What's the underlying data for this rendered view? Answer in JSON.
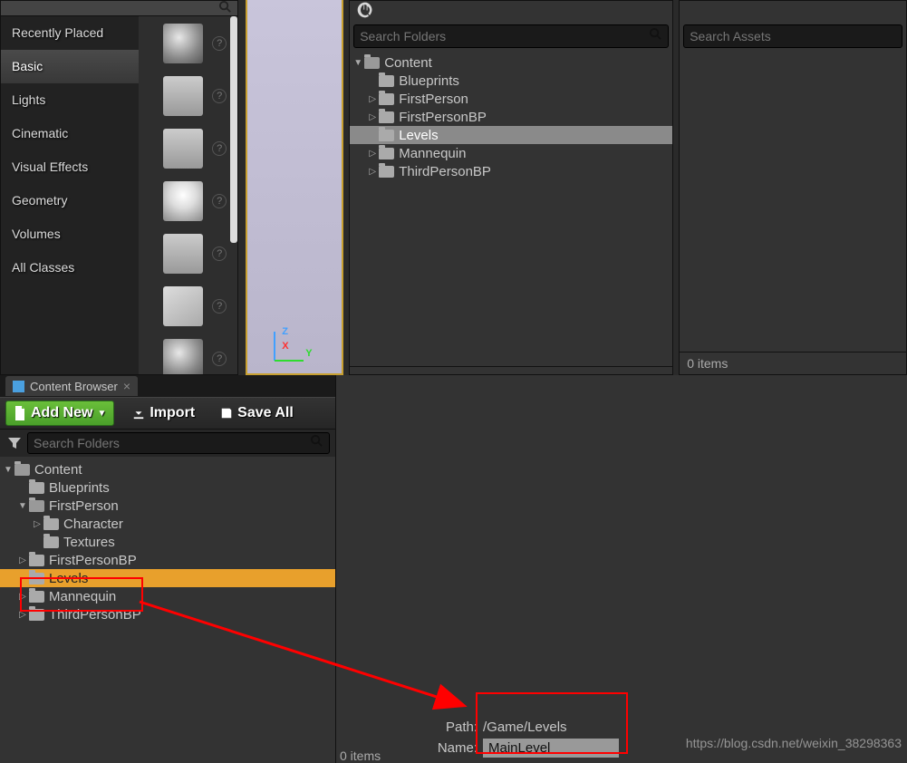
{
  "placement": {
    "categories": [
      "Recently Placed",
      "Basic",
      "Lights",
      "Cinematic",
      "Visual Effects",
      "Geometry",
      "Volumes",
      "All Classes"
    ],
    "selected": "Basic"
  },
  "topRight": {
    "searchFoldersPlaceholder": "Search Folders",
    "searchAssetsPlaceholder": "Search Assets",
    "tree": [
      {
        "label": "Content",
        "depth": 0,
        "expander": "▼",
        "open": true
      },
      {
        "label": "Blueprints",
        "depth": 1,
        "expander": "",
        "open": false
      },
      {
        "label": "FirstPerson",
        "depth": 1,
        "expander": "▷",
        "open": false
      },
      {
        "label": "FirstPersonBP",
        "depth": 1,
        "expander": "▷",
        "open": false
      },
      {
        "label": "Levels",
        "depth": 1,
        "expander": "",
        "open": false,
        "selected": true
      },
      {
        "label": "Mannequin",
        "depth": 1,
        "expander": "▷",
        "open": false
      },
      {
        "label": "ThirdPersonBP",
        "depth": 1,
        "expander": "▷",
        "open": false
      }
    ],
    "itemsLeft": "",
    "itemsRight": "0 items"
  },
  "contentBrowser": {
    "tabLabel": "Content Browser",
    "addNew": "Add New",
    "import": "Import",
    "saveAll": "Save All",
    "searchPlaceholder": "Search Folders",
    "tree": [
      {
        "label": "Content",
        "depth": 0,
        "expander": "▼",
        "open": true
      },
      {
        "label": "Blueprints",
        "depth": 1,
        "expander": "",
        "open": false
      },
      {
        "label": "FirstPerson",
        "depth": 1,
        "expander": "▼",
        "open": true
      },
      {
        "label": "Character",
        "depth": 2,
        "expander": "▷",
        "open": false
      },
      {
        "label": "Textures",
        "depth": 2,
        "expander": "",
        "open": false
      },
      {
        "label": "FirstPersonBP",
        "depth": 1,
        "expander": "▷",
        "open": false
      },
      {
        "label": "Levels",
        "depth": 1,
        "expander": "",
        "open": false,
        "selOrange": true
      },
      {
        "label": "Mannequin",
        "depth": 1,
        "expander": "▷",
        "open": false
      },
      {
        "label": "ThirdPersonBP",
        "depth": 1,
        "expander": "▷",
        "open": false
      }
    ]
  },
  "save": {
    "pathLabel": "Path:",
    "pathValue": "/Game/Levels",
    "nameLabel": "Name:",
    "nameValue": "MainLevel"
  },
  "footer": {
    "items": "0 items"
  },
  "watermark": "https://blog.csdn.net/weixin_38298363",
  "axis": {
    "z": "Z",
    "x": "X",
    "y": "Y"
  }
}
